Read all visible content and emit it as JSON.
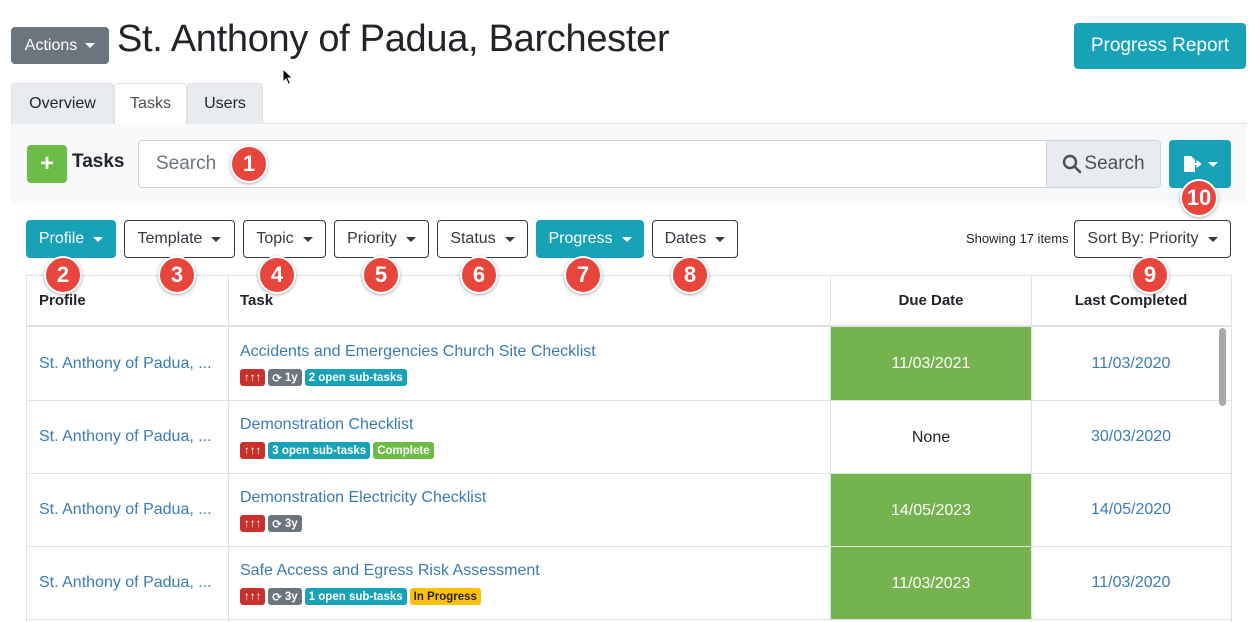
{
  "header": {
    "actions_label": "Actions",
    "title": "St. Anthony of Padua, Barchester",
    "progress_report_label": "Progress Report"
  },
  "tabs": [
    {
      "label": "Overview",
      "active": false
    },
    {
      "label": "Tasks",
      "active": true
    },
    {
      "label": "Users",
      "active": false
    }
  ],
  "toolbar": {
    "add_icon": "plus-icon",
    "tasks_label": "Tasks",
    "search_placeholder": "Search",
    "search_button_label": "Search",
    "export_icon": "file-export-icon"
  },
  "filters": [
    {
      "label": "Profile",
      "active": true
    },
    {
      "label": "Template",
      "active": false
    },
    {
      "label": "Topic",
      "active": false
    },
    {
      "label": "Priority",
      "active": false
    },
    {
      "label": "Status",
      "active": false
    },
    {
      "label": "Progress",
      "active": true
    },
    {
      "label": "Dates",
      "active": false
    }
  ],
  "showing_text": "Showing 17 items",
  "sort_label": "Sort By: Priority",
  "markers": [
    "1",
    "2",
    "3",
    "4",
    "5",
    "6",
    "7",
    "8",
    "9",
    "10"
  ],
  "table": {
    "headers": {
      "profile": "Profile",
      "task": "Task",
      "due_date": "Due Date",
      "last_completed": "Last Completed"
    },
    "rows": [
      {
        "profile": "St. Anthony of Padua, ...",
        "task": "Accidents and Emergencies Church Site Checklist",
        "badges": [
          {
            "type": "red",
            "text": "↑↑↑"
          },
          {
            "type": "grey",
            "icon": "sync-icon",
            "text": "1y"
          },
          {
            "type": "teal",
            "text": "2 open sub-tasks"
          }
        ],
        "due_date": "11/03/2021",
        "due_status": "ok",
        "last_completed": "11/03/2020"
      },
      {
        "profile": "St. Anthony of Padua, ...",
        "task": "Demonstration Checklist",
        "badges": [
          {
            "type": "red",
            "text": "↑↑↑"
          },
          {
            "type": "teal",
            "text": "3 open sub-tasks"
          },
          {
            "type": "green",
            "text": "Complete"
          }
        ],
        "due_date": "None",
        "due_status": "none",
        "last_completed": "30/03/2020"
      },
      {
        "profile": "St. Anthony of Padua, ...",
        "task": "Demonstration Electricity Checklist",
        "badges": [
          {
            "type": "red",
            "text": "↑↑↑"
          },
          {
            "type": "grey",
            "icon": "sync-icon",
            "text": "3y"
          }
        ],
        "due_date": "14/05/2023",
        "due_status": "ok",
        "last_completed": "14/05/2020"
      },
      {
        "profile": "St. Anthony of Padua, ...",
        "task": "Safe Access and Egress Risk Assessment",
        "badges": [
          {
            "type": "red",
            "text": "↑↑↑"
          },
          {
            "type": "grey",
            "icon": "sync-icon",
            "text": "3y"
          },
          {
            "type": "teal",
            "text": "1 open sub-tasks"
          },
          {
            "type": "yellow",
            "text": "In Progress"
          }
        ],
        "due_date": "11/03/2023",
        "due_status": "ok",
        "last_completed": "11/03/2020"
      }
    ]
  },
  "colors": {
    "teal": "#17a2b8",
    "green": "#75b34f",
    "red_badge": "#c8302b",
    "marker_red": "#e8453c",
    "link": "#3a7bb6"
  }
}
